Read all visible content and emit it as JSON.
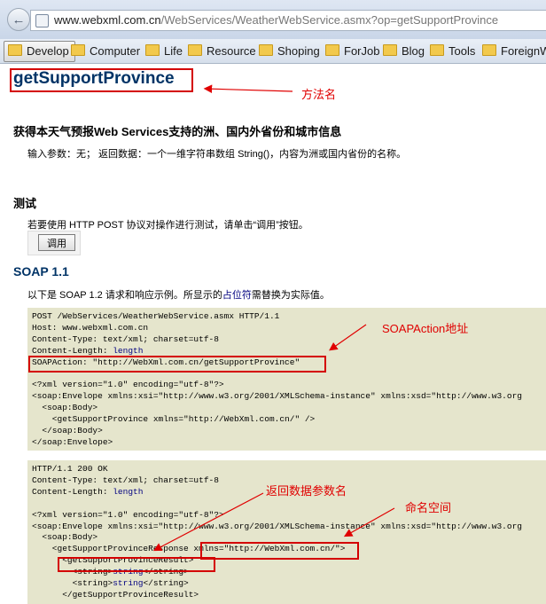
{
  "browser": {
    "url_host": "www.webxml.com.cn",
    "url_path": "/WebServices/WeatherWebService.asmx?op=getSupportProvince",
    "bookmarks": [
      "Develop",
      "Computer",
      "Life",
      "Resource",
      "Shoping",
      "ForJob",
      "Blog",
      "Tools",
      "ForeignW"
    ]
  },
  "page": {
    "method_title": "getSupportProvince",
    "description_heading": "获得本天气预报Web Services支持的洲、国内外省份和城市信息",
    "description_text": "输入参数：无；  返回数据：一个一维字符串数组 String()，内容为洲或国内省份的名称。",
    "test_heading": "测试",
    "test_text": "若要使用 HTTP POST 协议对操作进行测试，请单击“调用”按钮。",
    "invoke_label": "调用",
    "soap_heading": "SOAP 1.1",
    "soap_intro_before": "以下是 SOAP 1.2 请求和响应示例。所显示的",
    "soap_intro_placeholder": "占位符",
    "soap_intro_after": "需替换为实际值。"
  },
  "request": {
    "line1": "POST /WebServices/WeatherWebService.asmx HTTP/1.1",
    "line2": "Host: www.webxml.com.cn",
    "line3": "Content-Type: text/xml; charset=utf-8",
    "line4_label": "Content-Length: ",
    "line4_value": "length",
    "line5": "SOAPAction: \"http://WebXml.com.cn/getSupportProvince\"",
    "line6": "<?xml version=\"1.0\" encoding=\"utf-8\"?>",
    "line7": "<soap:Envelope xmlns:xsi=\"http://www.w3.org/2001/XMLSchema-instance\" xmlns:xsd=\"http://www.w3.org",
    "line8": "  <soap:Body>",
    "line9": "    <getSupportProvince xmlns=\"http://WebXml.com.cn/\" />",
    "line10": "  </soap:Body>",
    "line11": "</soap:Envelope>"
  },
  "response": {
    "line1": "HTTP/1.1 200 OK",
    "line2": "Content-Type: text/xml; charset=utf-8",
    "line3_label": "Content-Length: ",
    "line3_value": "length",
    "line4": "<?xml version=\"1.0\" encoding=\"utf-8\"?>",
    "line5": "<soap:Envelope xmlns:xsi=\"http://www.w3.org/2001/XMLSchema-instance\" xmlns:xsd=\"http://www.w3.org",
    "line6": "  <soap:Body>",
    "line7": "    <getSupportProvinceResponse xmlns=\"http://WebXml.com.cn/\">",
    "line8": "      <getSupportProvinceResult>",
    "line9_open": "        <string>",
    "line9_value": "string",
    "line9_close": "</string>",
    "line10_open": "        <string>",
    "line10_value": "string",
    "line10_close": "</string>",
    "line11": "      </getSupportProvinceResult>"
  },
  "annotations": {
    "method_name": "方法名",
    "soap_action": "SOAPAction地址",
    "return_param": "返回数据参数名",
    "namespace": "命名空间",
    "color": "#e00000"
  }
}
